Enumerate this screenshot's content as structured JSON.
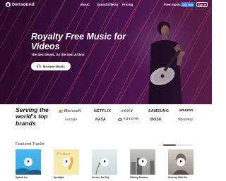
{
  "brand": {
    "logo_text": "bensound"
  },
  "nav": {
    "music": "Music",
    "sound_effects": "Sound Effects",
    "pricing": "Pricing",
    "free_music": "Free music",
    "join_now": "Join Now",
    "sign_in": "Sign in"
  },
  "hero": {
    "title": "Royalty Free Music for Videos",
    "subtitle": "The best Music, by the best Artists",
    "browse_button": "Browse Music"
  },
  "brands": {
    "title": "Serving the world's top brands",
    "items": [
      "Microsoft",
      "NETFLIX",
      "SONY",
      "SAMSUNG",
      "amazon",
      "Google",
      "NASA",
      "TOYOTA",
      "BOSE",
      "discovery"
    ]
  },
  "featured": {
    "title": "Featured Tracks",
    "tracks": [
      {
        "name": "Splash Lie",
        "artist": "",
        "cover_word": ""
      },
      {
        "name": "Spotlight",
        "artist": "",
        "cover_word": "Positive"
      },
      {
        "name": "No Her, No Day",
        "artist": "",
        "cover_word": ""
      },
      {
        "name": "Hittimg Shadow",
        "artist": "",
        "cover_word": ""
      },
      {
        "name": "Sharing With Her",
        "artist": "",
        "cover_word": ""
      }
    ]
  },
  "colors": {
    "hero_bg": "#4a1450",
    "accent_stripe": "#ff4696",
    "join_button": "#2f7cf6"
  }
}
